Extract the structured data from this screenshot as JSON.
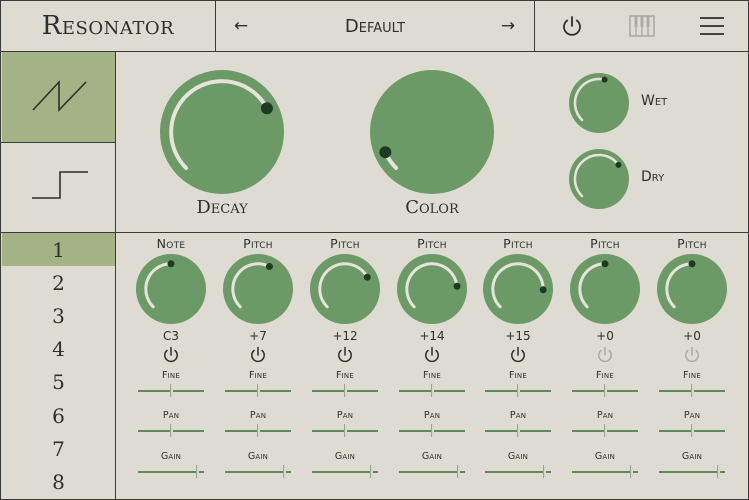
{
  "header": {
    "title": "Resonator",
    "preset_name": "Default",
    "prev_symbol": "←",
    "next_symbol": "→",
    "icons": [
      "power-icon",
      "piano-keys-icon",
      "hamburger-menu-icon"
    ]
  },
  "waveforms": [
    {
      "name": "sawtooth",
      "icon": "sawtooth-wave-icon",
      "selected": true
    },
    {
      "name": "square",
      "icon": "square-wave-icon",
      "selected": false
    }
  ],
  "main_knobs": {
    "decay": {
      "label": "Decay",
      "value": 0.73
    },
    "color": {
      "label": "Color",
      "value": 0.08
    },
    "wet": {
      "label": "Wet",
      "value": 0.55
    },
    "dry": {
      "label": "Dry",
      "value": 0.7
    }
  },
  "voices": {
    "items": [
      "1",
      "2",
      "3",
      "4",
      "5",
      "6",
      "7",
      "8"
    ],
    "selected": 0
  },
  "columns": [
    {
      "header": "Note",
      "value": "C3",
      "knob": 0.5,
      "enabled": true,
      "fine": 0.5,
      "pan": 0.5,
      "gain": 0.9
    },
    {
      "header": "Pitch",
      "value": "+7",
      "knob": 0.6,
      "enabled": true,
      "fine": 0.5,
      "pan": 0.5,
      "gain": 0.9
    },
    {
      "header": "Pitch",
      "value": "+12",
      "knob": 0.73,
      "enabled": true,
      "fine": 0.5,
      "pan": 0.5,
      "gain": 0.9
    },
    {
      "header": "Pitch",
      "value": "+14",
      "knob": 0.81,
      "enabled": true,
      "fine": 0.5,
      "pan": 0.5,
      "gain": 0.9
    },
    {
      "header": "Pitch",
      "value": "+15",
      "knob": 0.84,
      "enabled": true,
      "fine": 0.5,
      "pan": 0.5,
      "gain": 0.9
    },
    {
      "header": "Pitch",
      "value": "+0",
      "knob": 0.5,
      "enabled": false,
      "fine": 0.5,
      "pan": 0.5,
      "gain": 0.9
    },
    {
      "header": "Pitch",
      "value": "+0",
      "knob": 0.5,
      "enabled": false,
      "fine": 0.5,
      "pan": 0.5,
      "gain": 0.9
    }
  ],
  "slider_labels": {
    "fine": "Fine",
    "pan": "Pan",
    "gain": "Gain"
  },
  "colors": {
    "background": "#dedcd2",
    "knob": "#6c9a67",
    "knob_arc": "#e6e4da",
    "knob_dot": "#1f3a22",
    "selected": "#a3b386",
    "line": "#3a3c3a",
    "disabled": "#a9aba4"
  }
}
